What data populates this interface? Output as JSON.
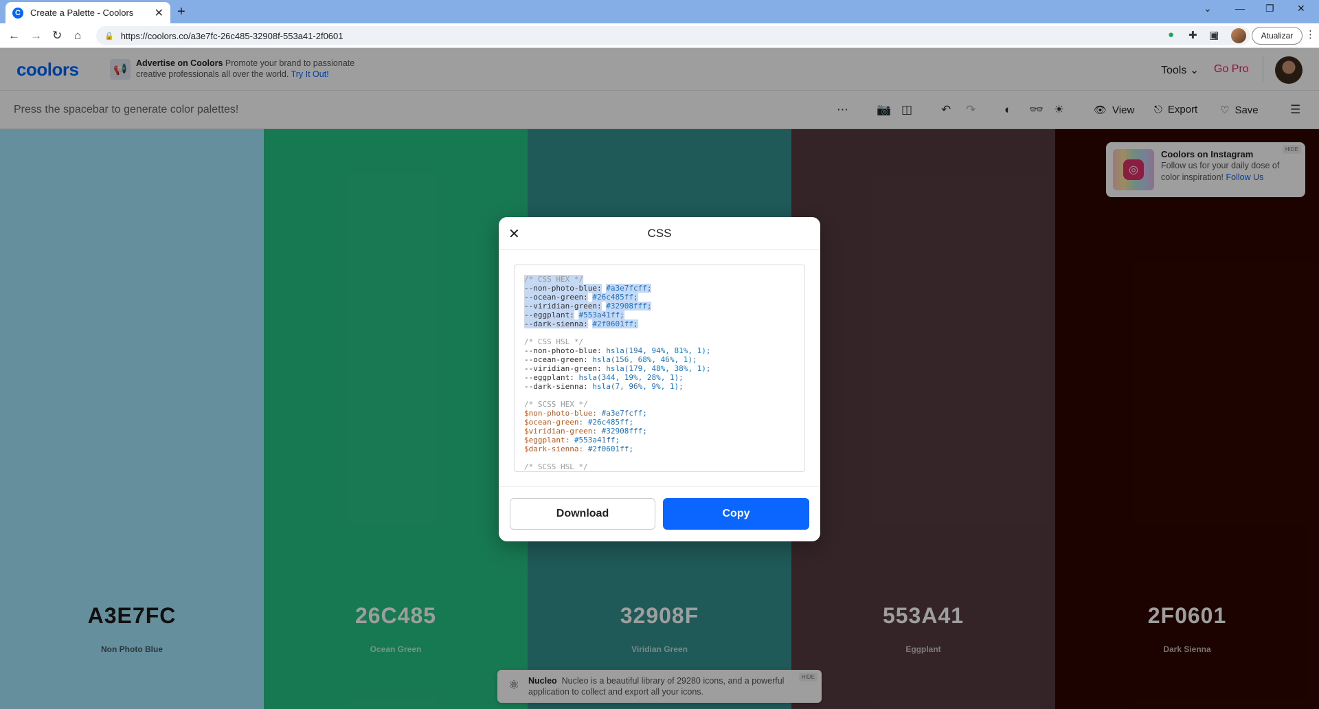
{
  "browser": {
    "tab_title": "Create a Palette - Coolors",
    "favicon_letter": "C",
    "url": "https://coolors.co/a3e7fc-26c485-32908f-553a41-2f0601",
    "update_label": "Atualizar"
  },
  "header": {
    "logo": "coolors",
    "ad_title": "Advertise on Coolors",
    "ad_body": "Promote your brand to passionate creative professionals all over the world.",
    "ad_cta": "Try It Out!",
    "tools_label": "Tools",
    "gopro_label": "Go Pro"
  },
  "toolbar": {
    "hint": "Press the spacebar to generate color palettes!",
    "view_label": "View",
    "export_label": "Export",
    "save_label": "Save"
  },
  "palette": [
    {
      "hex": "A3E7FC",
      "name": "Non Photo Blue",
      "color": "#a3e7fc",
      "text_color": "#1b1b1b"
    },
    {
      "hex": "26C485",
      "name": "Ocean Green",
      "color": "#26c485",
      "text_color": "#ffffff"
    },
    {
      "hex": "32908F",
      "name": "Viridian Green",
      "color": "#32908f",
      "text_color": "#ffffff"
    },
    {
      "hex": "553A41",
      "name": "Eggplant",
      "color": "#553a41",
      "text_color": "#ffffff"
    },
    {
      "hex": "2F0601",
      "name": "Dark Sienna",
      "color": "#2f0601",
      "text_color": "#ffffff"
    }
  ],
  "instagram_toast": {
    "title": "Coolors on Instagram",
    "body": "Follow us for your daily dose of color inspiration!",
    "link": "Follow Us",
    "hide": "HIDE"
  },
  "bottom_ad": {
    "title": "Nucleo",
    "body": "Nucleo is a beautiful library of 29280 icons, and a powerful application to collect and export all your icons.",
    "hide": "HIDE"
  },
  "modal": {
    "title": "CSS",
    "download_label": "Download",
    "copy_label": "Copy",
    "code": {
      "css_hex_comment": "/* CSS HEX */",
      "css_hex": [
        {
          "name": "--non-photo-blue:",
          "value": "#a3e7fcff;"
        },
        {
          "name": "--ocean-green:",
          "value": "#26c485ff;"
        },
        {
          "name": "--viridian-green:",
          "value": "#32908fff;"
        },
        {
          "name": "--eggplant:",
          "value": "#553a41ff;"
        },
        {
          "name": "--dark-sienna:",
          "value": "#2f0601ff;"
        }
      ],
      "css_hsl_comment": "/* CSS HSL */",
      "css_hsl": [
        {
          "name": "--non-photo-blue:",
          "value": "hsla(194, 94%, 81%, 1);"
        },
        {
          "name": "--ocean-green:",
          "value": "hsla(156, 68%, 46%, 1);"
        },
        {
          "name": "--viridian-green:",
          "value": "hsla(179, 48%, 38%, 1);"
        },
        {
          "name": "--eggplant:",
          "value": "hsla(344, 19%, 28%, 1);"
        },
        {
          "name": "--dark-sienna:",
          "value": "hsla(7, 96%, 9%, 1);"
        }
      ],
      "scss_hex_comment": "/* SCSS HEX */",
      "scss_hex": [
        {
          "name": "$non-photo-blue:",
          "value": "#a3e7fcff;"
        },
        {
          "name": "$ocean-green:",
          "value": "#26c485ff;"
        },
        {
          "name": "$viridian-green:",
          "value": "#32908fff;"
        },
        {
          "name": "$eggplant:",
          "value": "#553a41ff;"
        },
        {
          "name": "$dark-sienna:",
          "value": "#2f0601ff;"
        }
      ],
      "scss_hsl_comment": "/* SCSS HSL */"
    }
  }
}
